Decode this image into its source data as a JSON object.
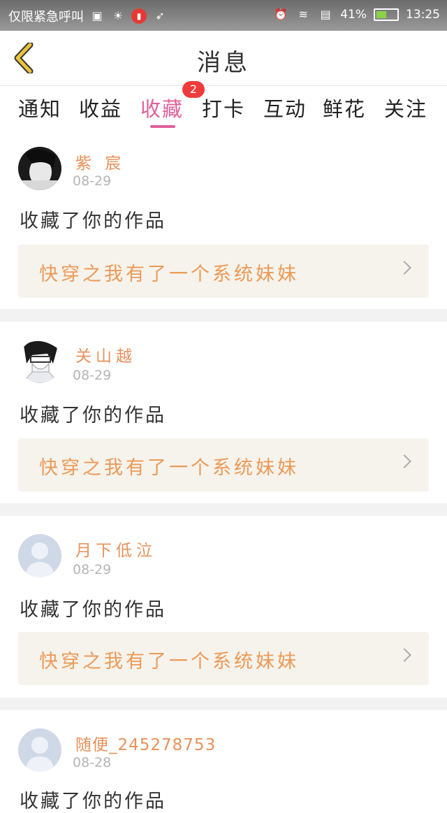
{
  "status_bar": {
    "carrier": "仅限紧急呼叫",
    "battery": "41%",
    "time": "13:25",
    "battery_level": 0.41
  },
  "nav": {
    "title": "消息",
    "back_icon": "chevron-left-icon"
  },
  "tabs": [
    {
      "label": "通知"
    },
    {
      "label": "收益"
    },
    {
      "label": "收藏",
      "active": true,
      "badge": "2"
    },
    {
      "label": "打卡"
    },
    {
      "label": "互动"
    },
    {
      "label": "鲜花"
    },
    {
      "label": "关注"
    }
  ],
  "messages": [
    {
      "user": "紫 宸",
      "date": "08-29",
      "action": "收藏了你的作品",
      "work": "快穿之我有了一个系统妹妹"
    },
    {
      "user": "关山越",
      "date": "08-29",
      "action": "收藏了你的作品",
      "work": "快穿之我有了一个系统妹妹"
    },
    {
      "user": "月下低泣",
      "date": "08-29",
      "action": "收藏了你的作品",
      "work": "快穿之我有了一个系统妹妹"
    },
    {
      "user": "随便_245278753",
      "date": "08-28",
      "action": "收藏了你的作品"
    }
  ],
  "colors": {
    "accent": "#e0609a",
    "username": "#e8915a",
    "work_title": "#ec9a57",
    "badge": "#ef3b3b",
    "back": "#e9c238"
  }
}
